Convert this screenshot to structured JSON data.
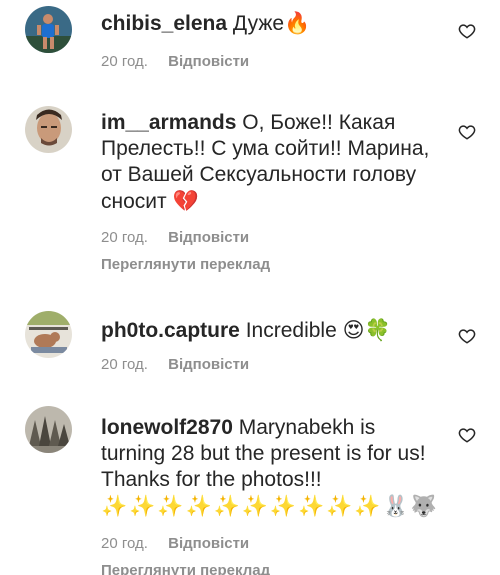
{
  "comments": [
    {
      "username": "chibis_elena",
      "text": "Дуже",
      "emoji": "🔥",
      "time": "20 год.",
      "reply": "Відповісти"
    },
    {
      "username": "im__armands",
      "text": "О, Боже!! Какая Прелесть!! С ума сойти!! Марина, от Вашей Сексуальности голову сносит",
      "emoji": "💔",
      "time": "20 год.",
      "reply": "Відповісти",
      "translate": "Переглянути переклад"
    },
    {
      "username": "ph0to.capture",
      "text": "Incredible",
      "emoji": "😍🍀",
      "time": "20 год.",
      "reply": "Відповісти"
    },
    {
      "username": "lonewolf2870",
      "text": "Marynabekh is turning 28 but the present is for us! Thanks for the photos!!!",
      "emoji": "✨✨✨✨✨✨✨✨✨✨🐰🐺",
      "time": "20 год.",
      "reply": "Відповісти",
      "translate": "Переглянути переклад"
    }
  ],
  "icons": {
    "like": "heart-outline-icon"
  },
  "colors": {
    "text": "#262626",
    "secondary": "#8e8e8e"
  }
}
